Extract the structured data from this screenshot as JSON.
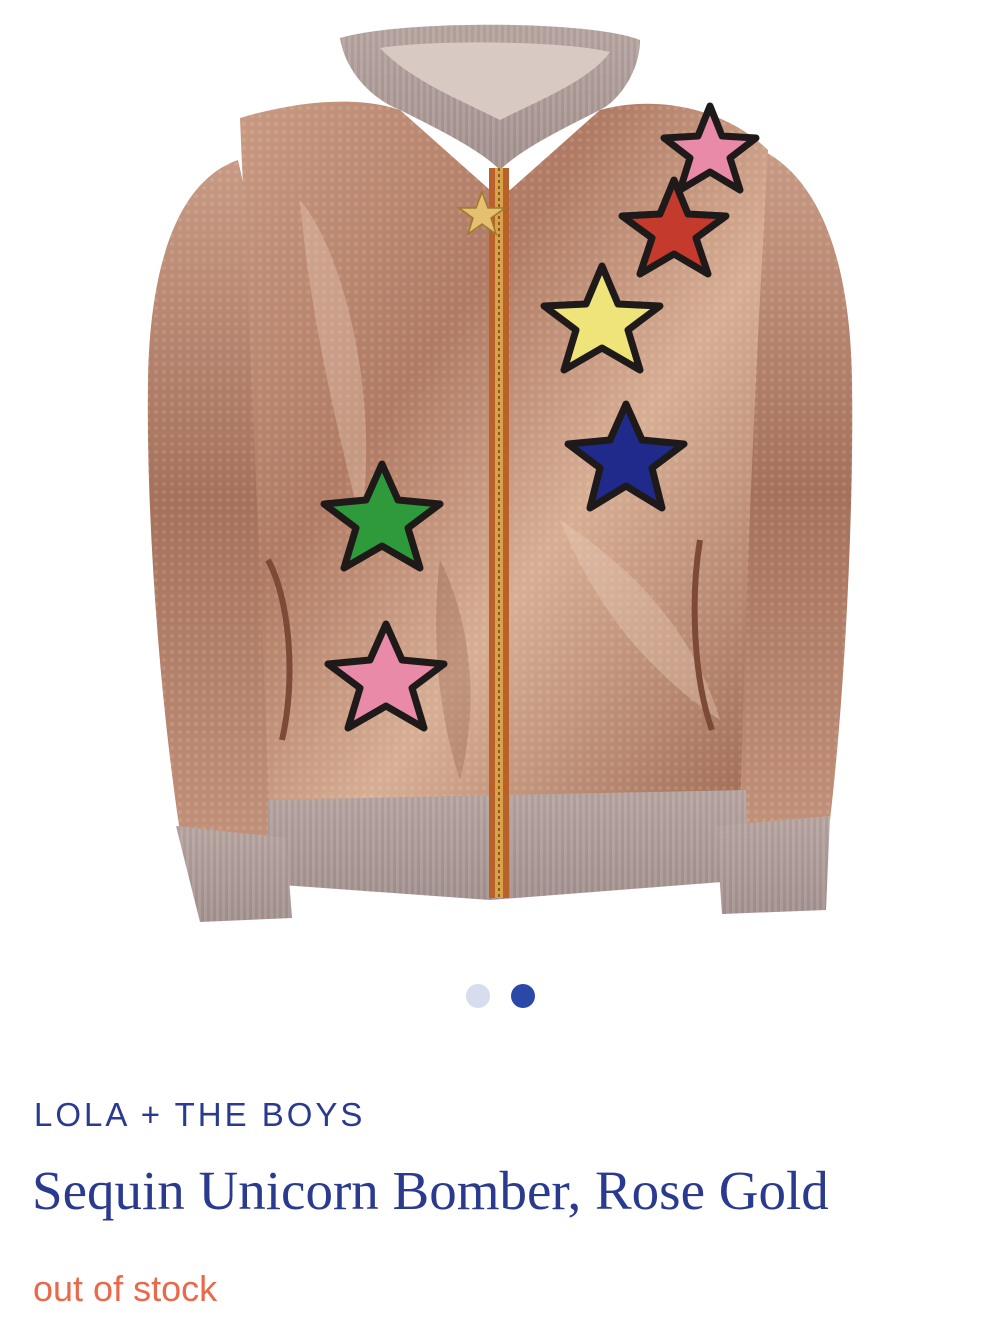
{
  "product": {
    "brand": "LOLA + THE BOYS",
    "name": "Sequin Unicorn Bomber, Rose Gold",
    "status": "out of stock",
    "image_subject": "rose-gold-sequin-bomber-jacket-with-star-patches"
  },
  "carousel": {
    "total": 2,
    "active": 2,
    "dots": [
      {
        "state": "inactive"
      },
      {
        "state": "active"
      }
    ]
  },
  "colors": {
    "text_primary": "#2a3a8f",
    "status": "#e86a4a",
    "dot_active": "#2a48a8",
    "dot_inactive": "#d7dcee",
    "background": "#ffffff"
  }
}
